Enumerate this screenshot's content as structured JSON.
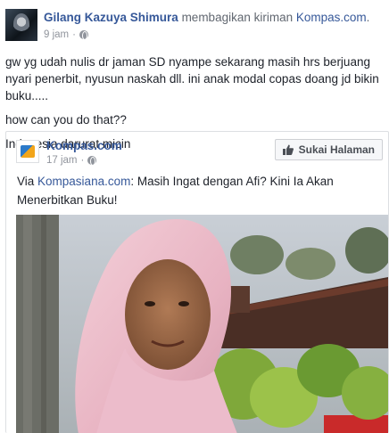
{
  "post": {
    "author": "Gilang Kazuya Shimura",
    "action": "membagikan kiriman",
    "shared_from": "Kompas.com",
    "punctuation": ".",
    "time": "9 jam",
    "separator": "·",
    "paragraphs": [
      "gw yg udah nulis dr jaman SD nyampe sekarang masih hrs berjuang nyari penerbit, nyusun naskah dll. ini anak modal copas doang jd bikin buku.....",
      "how can you do that??",
      "Indonesia darurat micin"
    ]
  },
  "shared": {
    "page_name": "Kompas.com",
    "time": "17 jam",
    "separator": "·",
    "like_button_label": "Sukai Halaman",
    "text_prefix": "Via ",
    "text_link": "Kompasiana.com",
    "text_body": ": Masih Ingat dengan Afi? Kini Ia Akan Menerbitkan Buku!"
  },
  "colors": {
    "link": "#365899",
    "meta": "#90949c",
    "body_text": "#1d2129"
  }
}
